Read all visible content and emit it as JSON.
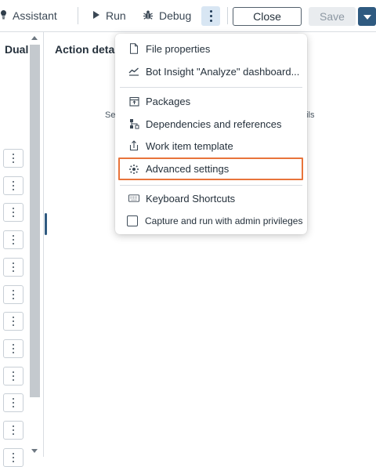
{
  "toolbar": {
    "assistant_label": "Assistant",
    "run_label": "Run",
    "debug_label": "Debug",
    "close_label": "Close",
    "save_label": "Save"
  },
  "left_panel": {
    "title": "Dual",
    "row_count": 12
  },
  "details": {
    "title": "Action detai",
    "fragment_left": "Se",
    "fragment_right": "ails"
  },
  "menu": {
    "items": [
      {
        "label": "File properties",
        "icon": "file-icon"
      },
      {
        "label": "Bot Insight \"Analyze\" dashboard...",
        "icon": "chart-line-icon"
      },
      {
        "label": "Packages",
        "icon": "package-icon"
      },
      {
        "label": "Dependencies and references",
        "icon": "dependencies-icon"
      },
      {
        "label": "Work item template",
        "icon": "work-item-icon"
      },
      {
        "label": "Advanced settings",
        "icon": "advanced-settings-icon"
      },
      {
        "label": "Keyboard Shortcuts",
        "icon": "keyboard-icon"
      },
      {
        "label": "Capture and run with admin privileges",
        "icon": "checkbox"
      }
    ]
  },
  "colors": {
    "accent": "#2f5a80",
    "highlight_border": "#e8743b",
    "more_button_bg": "#d8e6f3"
  }
}
